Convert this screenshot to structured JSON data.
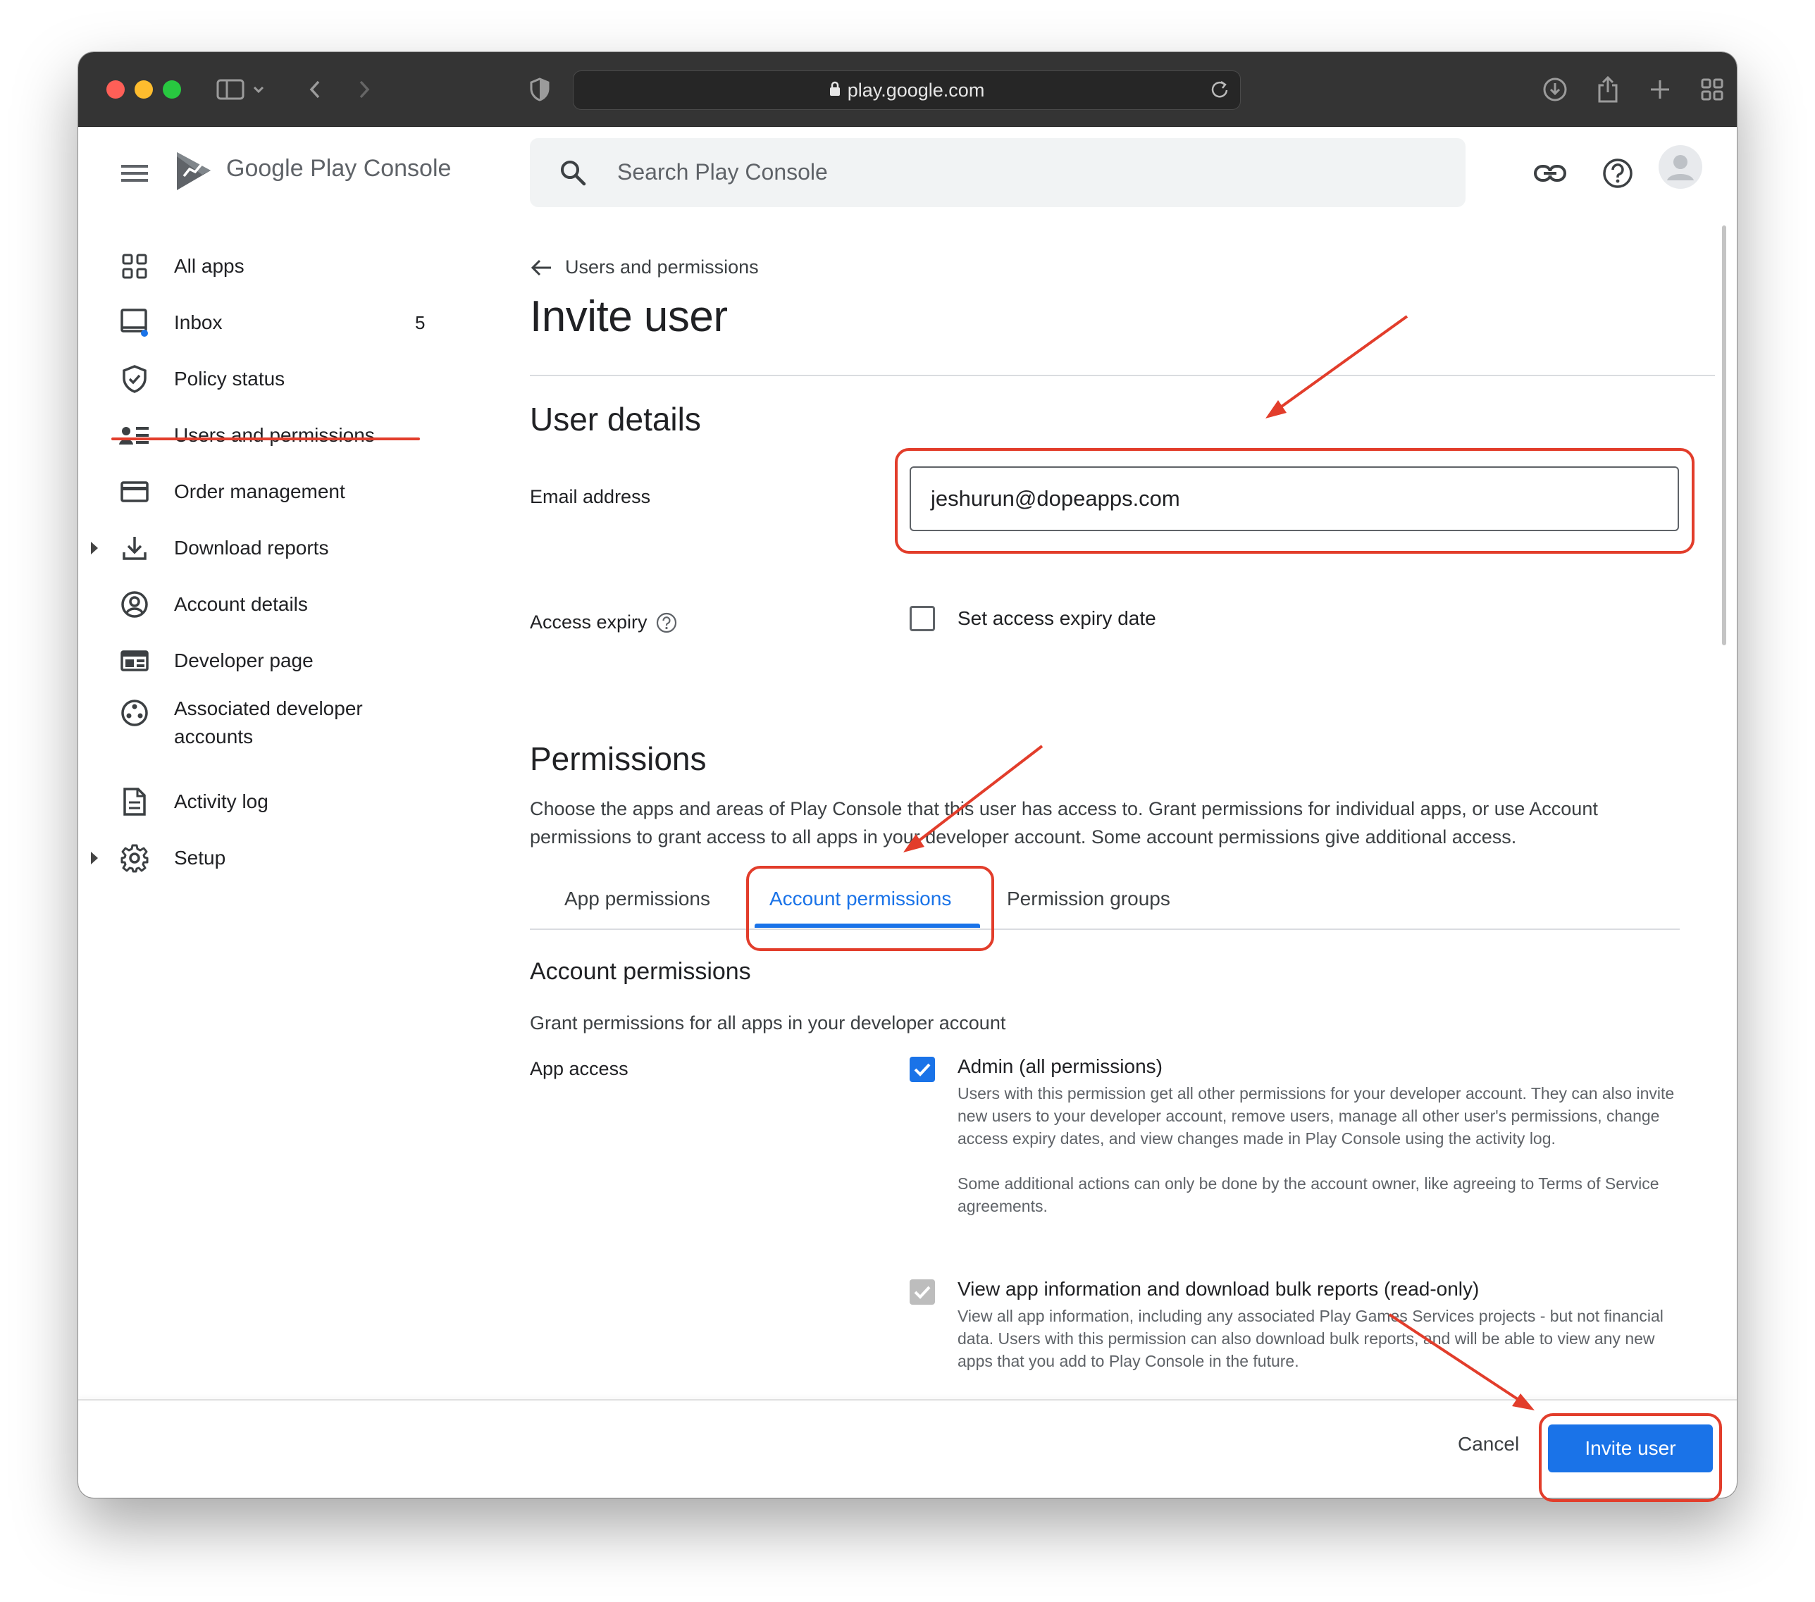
{
  "browser": {
    "url": "play.google.com"
  },
  "app": {
    "brand_google": "Google Play",
    "brand_console": "Console",
    "search_placeholder": "Search Play Console"
  },
  "sidebar": {
    "items": [
      {
        "label": "All apps",
        "icon": "grid-icon"
      },
      {
        "label": "Inbox",
        "icon": "inbox-icon",
        "count": "5"
      },
      {
        "label": "Policy status",
        "icon": "shield-icon"
      },
      {
        "label": "Users and permissions",
        "icon": "users-icon"
      },
      {
        "label": "Order management",
        "icon": "credit-card-icon"
      },
      {
        "label": "Download reports",
        "icon": "download-icon"
      },
      {
        "label": "Account details",
        "icon": "account-circle-icon"
      },
      {
        "label": "Developer page",
        "icon": "web-page-icon"
      },
      {
        "label": "Associated developer",
        "label2": "accounts",
        "icon": "associated-accounts-icon"
      },
      {
        "label": "Activity log",
        "icon": "document-icon"
      },
      {
        "label": "Setup",
        "icon": "gear-icon"
      }
    ]
  },
  "page": {
    "back_label": "Users and permissions",
    "title": "Invite user",
    "user_details_heading": "User details",
    "email_label": "Email address",
    "email_value": "jeshurun@dopeapps.com",
    "access_expiry_label": "Access expiry",
    "set_expiry_label": "Set access expiry date",
    "permissions_heading": "Permissions",
    "permissions_desc_line1": "Choose the apps and areas of Play Console that this user has access to. Grant permissions for individual apps, or use Account",
    "permissions_desc_line2": "permissions to grant access to all apps in your developer account. Some account permissions give additional access.",
    "tabs": [
      "App permissions",
      "Account permissions",
      "Permission groups"
    ],
    "active_tab": "Account permissions",
    "account_permissions_heading": "Account permissions",
    "account_permissions_desc": "Grant permissions for all apps in your developer account",
    "app_access_label": "App access",
    "admin_label": "Admin (all permissions)",
    "admin_desc": "Users with this permission get all other permissions for your developer account. They can also invite new users to your developer account, remove users, manage all other user's permissions, change access expiry dates, and view changes made in Play Console using the activity log.",
    "admin_desc2": "Some additional actions can only be done by the account owner, like agreeing to Terms of Service agreements.",
    "view_app_label": "View app information and download bulk reports (read-only)",
    "view_app_desc": "View all app information, including any associated Play Games Services projects - but not financial data. Users with this permission can also download bulk reports, and will be able to view any new apps that you add to Play Console in the future."
  },
  "footer": {
    "cancel_label": "Cancel",
    "invite_label": "Invite user"
  },
  "colors": {
    "accent": "#1a73e8",
    "annotation": "#e23d2b"
  }
}
